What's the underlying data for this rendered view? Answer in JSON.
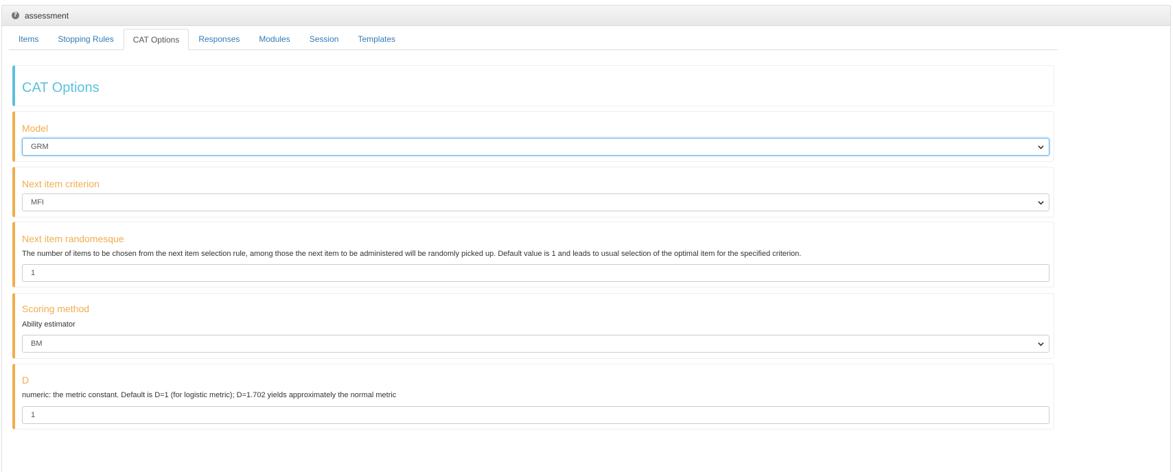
{
  "panel": {
    "title": "assessment",
    "help_icon": "question-circle-icon"
  },
  "tabs": [
    {
      "label": "Items",
      "active": false
    },
    {
      "label": "Stopping Rules",
      "active": false
    },
    {
      "label": "CAT Options",
      "active": true
    },
    {
      "label": "Responses",
      "active": false
    },
    {
      "label": "Modules",
      "active": false
    },
    {
      "label": "Session",
      "active": false
    },
    {
      "label": "Templates",
      "active": false
    }
  ],
  "header": {
    "title": "CAT Options"
  },
  "model": {
    "title": "Model",
    "value": "GRM"
  },
  "next_item_criterion": {
    "title": "Next item criterion",
    "value": "MFI"
  },
  "next_item_randomesque": {
    "title": "Next item randomesque",
    "description": "The number of items to be chosen from the next item selection rule, among those the next item to be administered will be randomly picked up. Default value is 1 and leads to usual selection of the optimal item for the specified criterion.",
    "value": "1"
  },
  "scoring_method": {
    "title": "Scoring method",
    "label": "Ability estimator",
    "value": "BM"
  },
  "d_constant": {
    "title": "D",
    "description": "numeric: the metric constant. Default is D=1 (for logistic metric); D=1.702 yields approximately the normal metric",
    "value": "1"
  },
  "colors": {
    "warning_accent": "#f0ad4e",
    "info_accent": "#5bc0de",
    "link": "#337ab7"
  }
}
